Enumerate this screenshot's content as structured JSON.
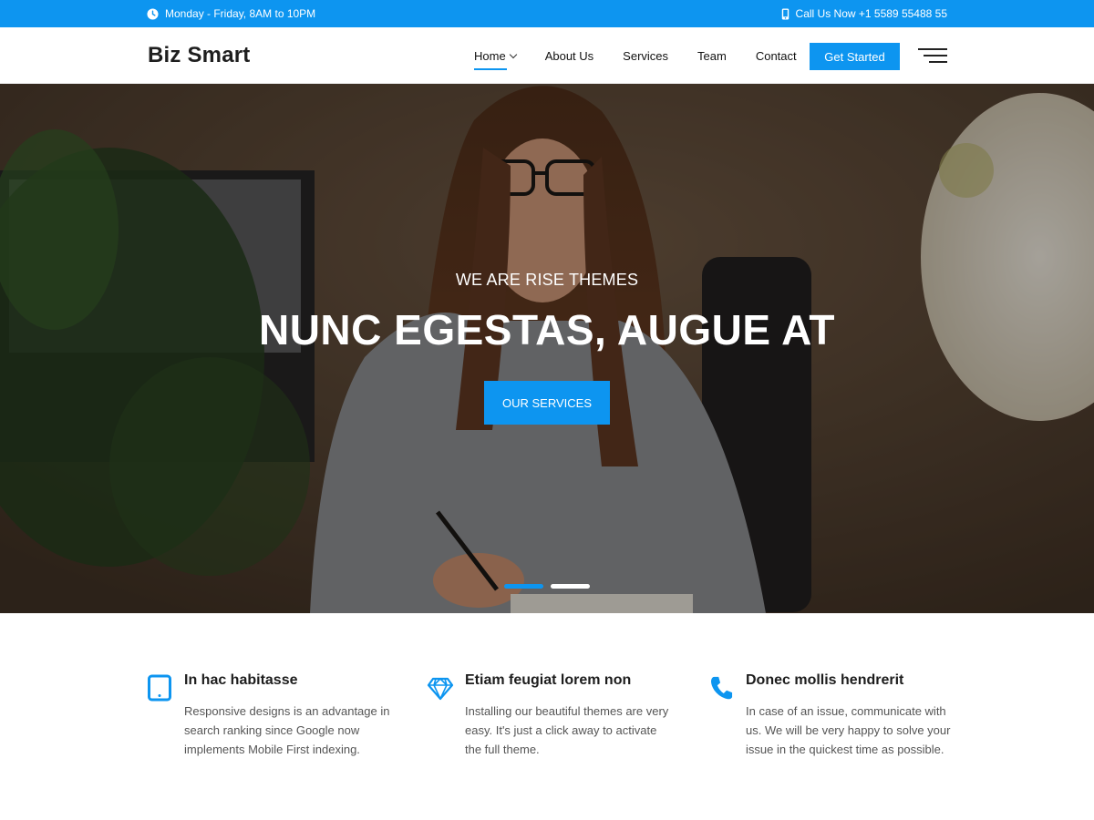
{
  "topbar": {
    "hours": "Monday - Friday, 8AM to 10PM",
    "phone": "Call Us Now +1 5589 55488 55",
    "icons": [
      "clock-icon",
      "phone-icon"
    ]
  },
  "header": {
    "logo": "Biz Smart",
    "nav": [
      {
        "label": "Home",
        "active": true,
        "has_dropdown": true
      },
      {
        "label": "About Us"
      },
      {
        "label": "Services"
      },
      {
        "label": "Team"
      },
      {
        "label": "Contact"
      }
    ],
    "cta_label": "Get Started",
    "menu_icon": "hamburger-menu-icon"
  },
  "hero": {
    "subtitle": "WE ARE RISE THEMES",
    "title": "NUNC EGESTAS, AUGUE AT",
    "button_label": "OUR SERVICES",
    "slides": [
      {
        "active": true
      },
      {
        "active": false
      }
    ]
  },
  "features": [
    {
      "icon": "tablet-icon",
      "title": "In hac habitasse",
      "text": "Responsive designs is an advantage in search ranking since Google now implements Mobile First indexing."
    },
    {
      "icon": "diamond-icon",
      "title": "Etiam feugiat lorem non",
      "text": "Installing our beautiful themes are very easy. It's just a click away to activate the full theme."
    },
    {
      "icon": "phone-icon",
      "title": "Donec mollis hendrerit",
      "text": "In case of an issue, communicate with us. We will be very happy to solve your issue in the quickest time as possible."
    }
  ],
  "colors": {
    "accent": "#0d95f0",
    "heading": "#1d1d1d",
    "body_text": "#555555"
  }
}
